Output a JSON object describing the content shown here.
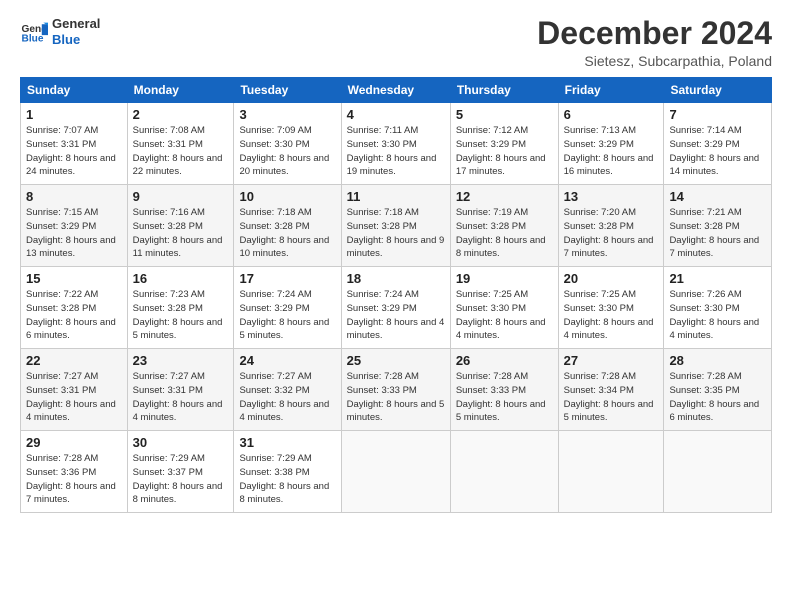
{
  "logo": {
    "line1": "General",
    "line2": "Blue"
  },
  "title": "December 2024",
  "subtitle": "Sietesz, Subcarpathia, Poland",
  "header": {
    "colors": {
      "bg": "#1565c0"
    }
  },
  "days_of_week": [
    "Sunday",
    "Monday",
    "Tuesday",
    "Wednesday",
    "Thursday",
    "Friday",
    "Saturday"
  ],
  "weeks": [
    [
      {
        "num": "1",
        "sunrise": "Sunrise: 7:07 AM",
        "sunset": "Sunset: 3:31 PM",
        "daylight": "Daylight: 8 hours and 24 minutes."
      },
      {
        "num": "2",
        "sunrise": "Sunrise: 7:08 AM",
        "sunset": "Sunset: 3:31 PM",
        "daylight": "Daylight: 8 hours and 22 minutes."
      },
      {
        "num": "3",
        "sunrise": "Sunrise: 7:09 AM",
        "sunset": "Sunset: 3:30 PM",
        "daylight": "Daylight: 8 hours and 20 minutes."
      },
      {
        "num": "4",
        "sunrise": "Sunrise: 7:11 AM",
        "sunset": "Sunset: 3:30 PM",
        "daylight": "Daylight: 8 hours and 19 minutes."
      },
      {
        "num": "5",
        "sunrise": "Sunrise: 7:12 AM",
        "sunset": "Sunset: 3:29 PM",
        "daylight": "Daylight: 8 hours and 17 minutes."
      },
      {
        "num": "6",
        "sunrise": "Sunrise: 7:13 AM",
        "sunset": "Sunset: 3:29 PM",
        "daylight": "Daylight: 8 hours and 16 minutes."
      },
      {
        "num": "7",
        "sunrise": "Sunrise: 7:14 AM",
        "sunset": "Sunset: 3:29 PM",
        "daylight": "Daylight: 8 hours and 14 minutes."
      }
    ],
    [
      {
        "num": "8",
        "sunrise": "Sunrise: 7:15 AM",
        "sunset": "Sunset: 3:29 PM",
        "daylight": "Daylight: 8 hours and 13 minutes."
      },
      {
        "num": "9",
        "sunrise": "Sunrise: 7:16 AM",
        "sunset": "Sunset: 3:28 PM",
        "daylight": "Daylight: 8 hours and 11 minutes."
      },
      {
        "num": "10",
        "sunrise": "Sunrise: 7:18 AM",
        "sunset": "Sunset: 3:28 PM",
        "daylight": "Daylight: 8 hours and 10 minutes."
      },
      {
        "num": "11",
        "sunrise": "Sunrise: 7:18 AM",
        "sunset": "Sunset: 3:28 PM",
        "daylight": "Daylight: 8 hours and 9 minutes."
      },
      {
        "num": "12",
        "sunrise": "Sunrise: 7:19 AM",
        "sunset": "Sunset: 3:28 PM",
        "daylight": "Daylight: 8 hours and 8 minutes."
      },
      {
        "num": "13",
        "sunrise": "Sunrise: 7:20 AM",
        "sunset": "Sunset: 3:28 PM",
        "daylight": "Daylight: 8 hours and 7 minutes."
      },
      {
        "num": "14",
        "sunrise": "Sunrise: 7:21 AM",
        "sunset": "Sunset: 3:28 PM",
        "daylight": "Daylight: 8 hours and 7 minutes."
      }
    ],
    [
      {
        "num": "15",
        "sunrise": "Sunrise: 7:22 AM",
        "sunset": "Sunset: 3:28 PM",
        "daylight": "Daylight: 8 hours and 6 minutes."
      },
      {
        "num": "16",
        "sunrise": "Sunrise: 7:23 AM",
        "sunset": "Sunset: 3:28 PM",
        "daylight": "Daylight: 8 hours and 5 minutes."
      },
      {
        "num": "17",
        "sunrise": "Sunrise: 7:24 AM",
        "sunset": "Sunset: 3:29 PM",
        "daylight": "Daylight: 8 hours and 5 minutes."
      },
      {
        "num": "18",
        "sunrise": "Sunrise: 7:24 AM",
        "sunset": "Sunset: 3:29 PM",
        "daylight": "Daylight: 8 hours and 4 minutes."
      },
      {
        "num": "19",
        "sunrise": "Sunrise: 7:25 AM",
        "sunset": "Sunset: 3:30 PM",
        "daylight": "Daylight: 8 hours and 4 minutes."
      },
      {
        "num": "20",
        "sunrise": "Sunrise: 7:25 AM",
        "sunset": "Sunset: 3:30 PM",
        "daylight": "Daylight: 8 hours and 4 minutes."
      },
      {
        "num": "21",
        "sunrise": "Sunrise: 7:26 AM",
        "sunset": "Sunset: 3:30 PM",
        "daylight": "Daylight: 8 hours and 4 minutes."
      }
    ],
    [
      {
        "num": "22",
        "sunrise": "Sunrise: 7:27 AM",
        "sunset": "Sunset: 3:31 PM",
        "daylight": "Daylight: 8 hours and 4 minutes."
      },
      {
        "num": "23",
        "sunrise": "Sunrise: 7:27 AM",
        "sunset": "Sunset: 3:31 PM",
        "daylight": "Daylight: 8 hours and 4 minutes."
      },
      {
        "num": "24",
        "sunrise": "Sunrise: 7:27 AM",
        "sunset": "Sunset: 3:32 PM",
        "daylight": "Daylight: 8 hours and 4 minutes."
      },
      {
        "num": "25",
        "sunrise": "Sunrise: 7:28 AM",
        "sunset": "Sunset: 3:33 PM",
        "daylight": "Daylight: 8 hours and 5 minutes."
      },
      {
        "num": "26",
        "sunrise": "Sunrise: 7:28 AM",
        "sunset": "Sunset: 3:33 PM",
        "daylight": "Daylight: 8 hours and 5 minutes."
      },
      {
        "num": "27",
        "sunrise": "Sunrise: 7:28 AM",
        "sunset": "Sunset: 3:34 PM",
        "daylight": "Daylight: 8 hours and 5 minutes."
      },
      {
        "num": "28",
        "sunrise": "Sunrise: 7:28 AM",
        "sunset": "Sunset: 3:35 PM",
        "daylight": "Daylight: 8 hours and 6 minutes."
      }
    ],
    [
      {
        "num": "29",
        "sunrise": "Sunrise: 7:28 AM",
        "sunset": "Sunset: 3:36 PM",
        "daylight": "Daylight: 8 hours and 7 minutes."
      },
      {
        "num": "30",
        "sunrise": "Sunrise: 7:29 AM",
        "sunset": "Sunset: 3:37 PM",
        "daylight": "Daylight: 8 hours and 8 minutes."
      },
      {
        "num": "31",
        "sunrise": "Sunrise: 7:29 AM",
        "sunset": "Sunset: 3:38 PM",
        "daylight": "Daylight: 8 hours and 8 minutes."
      },
      null,
      null,
      null,
      null
    ]
  ]
}
